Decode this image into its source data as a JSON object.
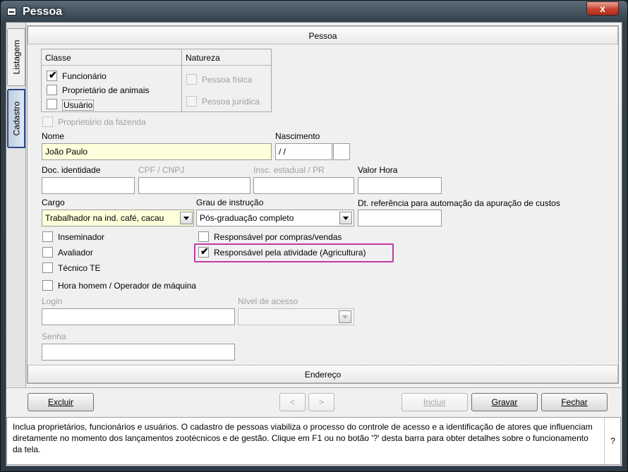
{
  "window": {
    "title": "Pessoa",
    "close": "x"
  },
  "tabs": {
    "listagem": "Listagem",
    "cadastro": "Cadastro"
  },
  "section": {
    "pessoa": "Pessoa",
    "endereco": "Endereço"
  },
  "classe": {
    "header": "Classe",
    "items": [
      {
        "label": "Funcionário",
        "checked": true
      },
      {
        "label": "Proprietário de animais",
        "checked": false
      },
      {
        "label": "Usuário",
        "checked": false
      }
    ]
  },
  "natureza": {
    "header": "Natureza",
    "items": [
      {
        "label": "Pessoa física",
        "checked": false
      },
      {
        "label": "Pessoa jurídica",
        "checked": false
      }
    ]
  },
  "proprietario_fazenda": "Proprietário da fazenda",
  "fields": {
    "nome_label": "Nome",
    "nome_value": "João Paulo",
    "nascimento_label": "Nascimento",
    "nascimento_value": " / /",
    "doc_label": "Doc. identidade",
    "doc_value": "",
    "cpf_label": "CPF / CNPJ",
    "cpf_value": "",
    "insc_label": "Insc. estadual / PR",
    "insc_value": "",
    "valor_label": "Valor Hora",
    "valor_value": "",
    "cargo_label": "Cargo",
    "cargo_value": "Trabalhador na ind. café, cacau",
    "grau_label": "Grau de instrução",
    "grau_value": "Pós-graduação completo",
    "dt_label": "Dt. referência para automação da apuração de custos",
    "dt_value": "",
    "login_label": "Login",
    "login_value": "",
    "nivel_label": "Nível de acesso",
    "nivel_value": "",
    "senha_label": "Senha",
    "senha_value": ""
  },
  "checks": {
    "inseminador": "Inseminador",
    "avaliador": "Avaliador",
    "tecnico": "Técnico TE",
    "hora_homem": "Hora homem / Operador de máquina",
    "resp_compras": "Responsável por compras/vendas",
    "resp_atividade": "Responsável pela atividade (Agricultura)"
  },
  "buttons": {
    "excluir": "Excluir",
    "prev": "<",
    "next": ">",
    "incluir": "Incluir",
    "gravar": "Gravar",
    "fechar": "Fechar"
  },
  "help": {
    "text": "Inclua proprietários, funcionários e usuários. O cadastro de pessoas viabiliza o processo do controle de acesso e a identificação de atores que influenciam diretamente no momento dos lançamentos zootécnicos e de gestão. Clique em F1 ou no botão '?' desta barra para obter detalhes sobre o funcionamento da tela.",
    "button": "?"
  },
  "colors": {
    "highlight": "#c13ba8",
    "yellow_field": "#ffffdc",
    "active_tab": "#2c4a85"
  }
}
